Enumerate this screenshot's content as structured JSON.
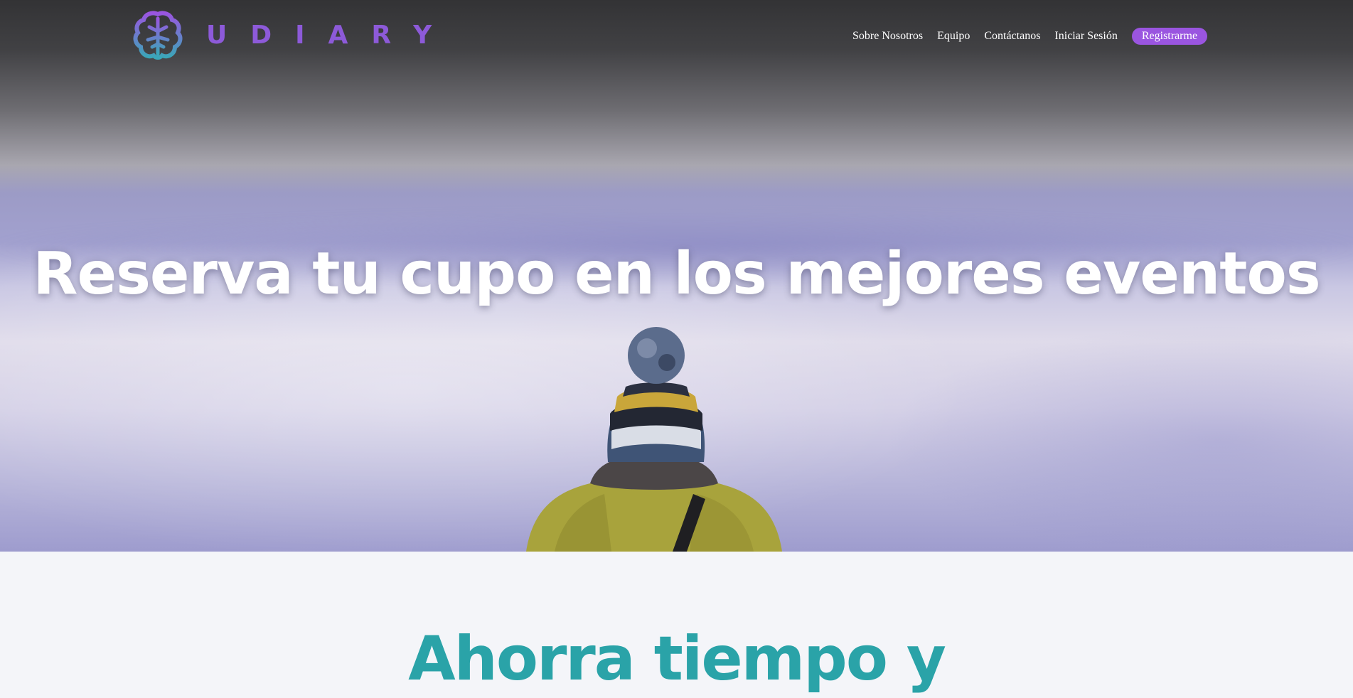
{
  "brand": {
    "name": "UDIARY",
    "color": "#8d5ad9",
    "logo_icon": "brain-icon"
  },
  "nav": {
    "links": [
      "Sobre Nosotros",
      "Equipo",
      "Contáctanos",
      "Iniciar Sesión"
    ],
    "register_label": "Registrarme",
    "register_color": "#9a55e0"
  },
  "hero": {
    "title": "Reserva tu cupo en los mejores eventos",
    "image": "person-beanie-above-clouds"
  },
  "section": {
    "title": "Ahorra tiempo y",
    "color": "#2aa3a8"
  }
}
